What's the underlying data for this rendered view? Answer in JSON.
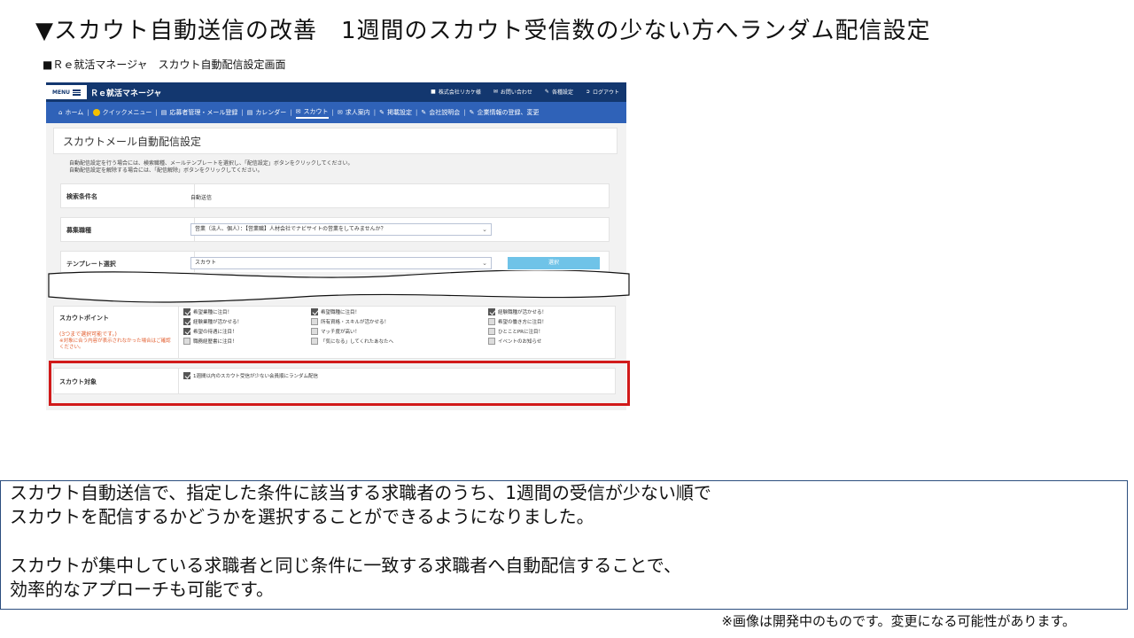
{
  "slide": {
    "title": "▼スカウト自動送信の改善　1週間のスカウト受信数の少ない方へランダム配信設定",
    "caption": "■Ｒｅ就活マネージャ　スカウト自動配信設定画面",
    "description": {
      "line1": "スカウト自動送信で、指定した条件に該当する求職者のうち、1週間の受信が少ない順で",
      "line2": "スカウトを配信するかどうかを選択することができるようになりました。",
      "line3": "スカウトが集中している求職者と同じ条件に一致する求職者へ自動配信することで、",
      "line4": "効率的なアプローチも可能です。"
    },
    "footnote": "※画像は開発中のものです。変更になる可能性があります。"
  },
  "app": {
    "menu_label": "MENU",
    "name": "Ｒｅ就活マネージャ",
    "top_links": [
      "株式会社リカケ様",
      "お問い合わせ",
      "各種設定",
      "ログアウト"
    ],
    "nav": [
      "ホーム",
      "クイックメニュー",
      "応募者管理・メール登録",
      "カレンダー",
      "スカウト",
      "求人案内",
      "掲載設定",
      "会社説明会",
      "企業情報の登録、変更"
    ],
    "page_title": "スカウトメール自動配信設定",
    "instructions": [
      "自動配信設定を行う場合には、検索職種、メールテンプレートを選択し、「配信設定」ボタンをクリックしてください。",
      "自動配信設定を解除する場合には、「配信解除」ボタンをクリックしてください。"
    ],
    "search_label": "検索条件名",
    "search_value": "自動送信",
    "job_label": "募集職種",
    "job_value": "営業（法人、個人）：【営業職】人材会社でナビサイトの営業をしてみませんか？",
    "template_label": "テンプレート選択",
    "template_value": "スカウト",
    "select_button": "選択",
    "points_label": "スカウトポイント",
    "points_note1": "(3つまで選択可能です。)",
    "points_note2": "※対象に合う内容が表示されなかった場合はご確認ください。",
    "checkboxes": [
      {
        "label": "希望業種に注目！",
        "checked": true
      },
      {
        "label": "希望職種に注目！",
        "checked": true
      },
      {
        "label": "経験職種が活かせる！",
        "checked": true
      },
      {
        "label": "経験業種が活かせる！",
        "checked": true
      },
      {
        "label": "所有資格・スキルが活かせる！",
        "checked": false
      },
      {
        "label": "希望の働き方に注目！",
        "checked": false
      },
      {
        "label": "希望の待遇に注目！",
        "checked": true
      },
      {
        "label": "マッチ度が高い！",
        "checked": false
      },
      {
        "label": "ひとことPRに注目！",
        "checked": false
      },
      {
        "label": "職務経歴書に注目！",
        "checked": false
      },
      {
        "label": "「気になる」してくれたあなたへ",
        "checked": false
      },
      {
        "label": "イベントのお知らせ",
        "checked": false
      }
    ],
    "target_label": "スカウト対象",
    "target_option": "1週間以内のスカウト受信が少ない会員順にランダム配信",
    "target_checked": true
  }
}
